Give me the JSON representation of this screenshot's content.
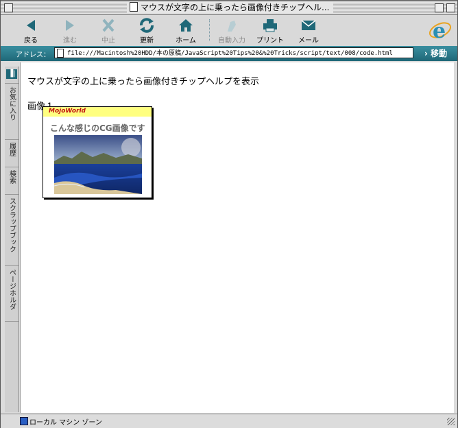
{
  "window": {
    "title": "マウスが文字の上に乗ったら画像付きチップヘル..."
  },
  "toolbar": {
    "buttons": [
      {
        "label": "戻る",
        "icon": "back-arrow-icon",
        "enabled": true
      },
      {
        "label": "進む",
        "icon": "forward-arrow-icon",
        "enabled": false
      },
      {
        "label": "中止",
        "icon": "stop-x-icon",
        "enabled": false
      },
      {
        "label": "更新",
        "icon": "refresh-icon",
        "enabled": true
      },
      {
        "label": "ホーム",
        "icon": "home-icon",
        "enabled": true
      },
      {
        "label": "自動入力",
        "icon": "autofill-icon",
        "enabled": false
      },
      {
        "label": "プリント",
        "icon": "printer-icon",
        "enabled": true
      },
      {
        "label": "メール",
        "icon": "mail-icon",
        "enabled": true
      }
    ]
  },
  "address": {
    "label": "アドレス：",
    "url": "file:///Macintosh%20HDD/本の原稿/JavaScript%20Tips%20&%20Tricks/script/text/008/code.html",
    "go_label": "移動"
  },
  "sidebar": {
    "tabs": [
      "お気に入り",
      "履歴",
      "検索",
      "スクラップブック",
      "ページホルダ"
    ]
  },
  "page": {
    "heading": "マウスが文字の上に乗ったら画像付きチップヘルプを表示",
    "image_link": "画像１",
    "tooltip": {
      "brand": "MojoWorld",
      "caption": "こんな感じのCG画像です"
    }
  },
  "status": {
    "zone": "ローカル マシン ゾーン"
  },
  "colors": {
    "accent": "#1f6878",
    "tooltip_header": "#ffff80",
    "brand_red": "#c01010"
  }
}
